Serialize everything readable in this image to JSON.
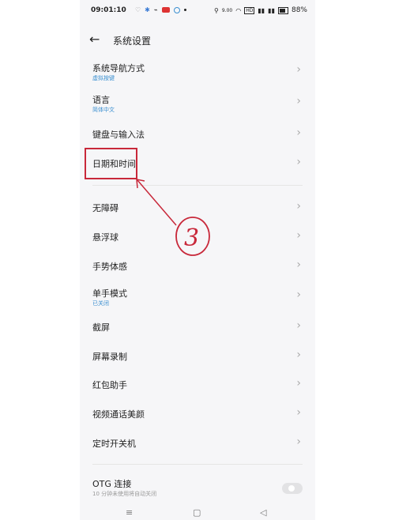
{
  "status_bar": {
    "time": "09:01:10",
    "battery_text": "88%",
    "speed_text": "9.00",
    "net_badge": "HD"
  },
  "header": {
    "back_icon": "arrow-left-icon",
    "title": "系统设置"
  },
  "items": [
    {
      "title": "系统导航方式",
      "subtitle": "虚拟按键"
    },
    {
      "title": "语言",
      "subtitle": "简体中文"
    },
    {
      "title": "键盘与输入法",
      "subtitle": ""
    },
    {
      "title": "日期和时间",
      "subtitle": ""
    },
    {
      "title": "无障碍",
      "subtitle": ""
    },
    {
      "title": "悬浮球",
      "subtitle": ""
    },
    {
      "title": "手势体感",
      "subtitle": ""
    },
    {
      "title": "单手模式",
      "subtitle": "已关闭"
    },
    {
      "title": "截屏",
      "subtitle": ""
    },
    {
      "title": "屏幕录制",
      "subtitle": ""
    },
    {
      "title": "红包助手",
      "subtitle": ""
    },
    {
      "title": "视频通话美颜",
      "subtitle": ""
    },
    {
      "title": "定时开关机",
      "subtitle": ""
    }
  ],
  "otg": {
    "title": "OTG 连接",
    "subtitle": "10 分钟未使用将自动关闭"
  },
  "annotation": {
    "number": "3",
    "color": "#c8283a"
  },
  "nav": {
    "menu_icon": "≡",
    "home_icon": "▢",
    "back_icon": "◁"
  }
}
